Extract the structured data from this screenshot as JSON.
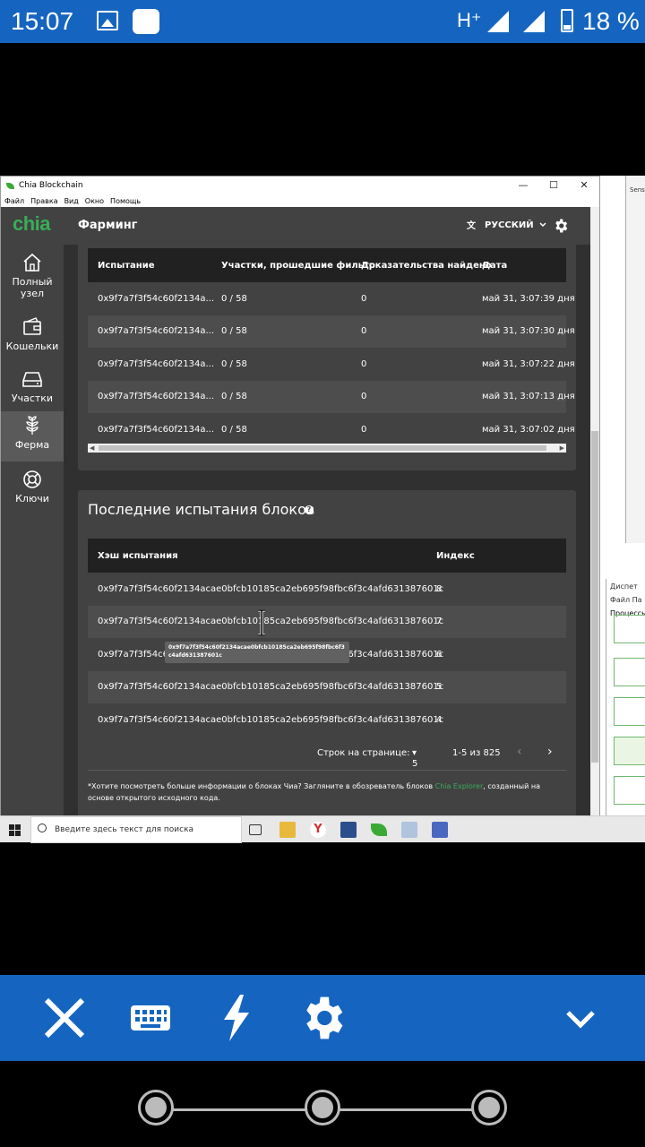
{
  "status_bar": {
    "time": "15:07",
    "network": "H⁺",
    "battery": "18 %"
  },
  "window": {
    "title": "Chia Blockchain",
    "menu": [
      "Файл",
      "Правка",
      "Вид",
      "Окно",
      "Помощь"
    ],
    "controls": [
      "—",
      "☐",
      "✕"
    ]
  },
  "app": {
    "logo": "chia",
    "page_title": "Фарминг",
    "language": "РУССКИЙ"
  },
  "sidebar": {
    "items": [
      {
        "label": "Полный узел",
        "icon": "home-icon"
      },
      {
        "label": "Кошельки",
        "icon": "wallet-icon"
      },
      {
        "label": "Участки",
        "icon": "storage-icon"
      },
      {
        "label": "Ферма",
        "icon": "farm-icon",
        "active": true
      },
      {
        "label": "Ключи",
        "icon": "lifebuoy-icon"
      }
    ]
  },
  "challenges_table": {
    "headers": [
      "Испытание",
      "Участки, прошедшие фильтр",
      "Доказательства найдено",
      "Дата"
    ],
    "rows": [
      [
        "0x9f7a7f3f54c60f2134a...",
        "0 / 58",
        "0",
        "май 31, 3:07:39 дня"
      ],
      [
        "0x9f7a7f3f54c60f2134a...",
        "0 / 58",
        "0",
        "май 31, 3:07:30 дня"
      ],
      [
        "0x9f7a7f3f54c60f2134a...",
        "0 / 58",
        "0",
        "май 31, 3:07:22 дня"
      ],
      [
        "0x9f7a7f3f54c60f2134a...",
        "0 / 58",
        "0",
        "май 31, 3:07:13 дня"
      ],
      [
        "0x9f7a7f3f54c60f2134a...",
        "0 / 58",
        "0",
        "май 31, 3:07:02 дня"
      ]
    ]
  },
  "block_challenges": {
    "title": "Последние испытания блоков",
    "help": "?",
    "headers": [
      "Хэш испытания",
      "Индекс"
    ],
    "rows": [
      [
        "0x9f7a7f3f54c60f2134acae0bfcb10185ca2eb695f98fbc6f3c4afd631387601c",
        "8"
      ],
      [
        "0x9f7a7f3f54c60f2134acae0bfcb10185ca2eb695f98fbc6f3c4afd631387601c",
        "7"
      ],
      [
        "0x9f7a7f3f54c60f2134acae0bfcb10185ca2eb695f98fbc6f3c4afd631387601c",
        "6"
      ],
      [
        "0x9f7a7f3f54c60f2134acae0bfcb10185ca2eb695f98fbc6f3c4afd631387601c",
        "5"
      ],
      [
        "0x9f7a7f3f54c60f2134acae0bfcb10185ca2eb695f98fbc6f3c4afd631387601c",
        "4"
      ]
    ],
    "tooltip": "0x9f7a7f3f54c60f2134acae0bfcb10185ca2eb695f98fbc6f3c4afd631387601c",
    "pager": {
      "rows_label": "Строк на странице:",
      "rows_value": "5",
      "range": "1-5 из 825"
    },
    "footnote_prefix": "*Хотите посмотреть больше информации о блоках Чиа? Загляните в обозреватель блоков ",
    "footnote_link": "Chia Explorer",
    "footnote_suffix": ", созданный на основе открытого исходного кода."
  },
  "side_windows": {
    "win1_label": "Sens",
    "win2_title": "Диспет",
    "win2_menu": "Файл  Па",
    "win2_tab": "Процессы"
  },
  "taskbar": {
    "search_placeholder": "Введите здесь текст для поиска"
  }
}
